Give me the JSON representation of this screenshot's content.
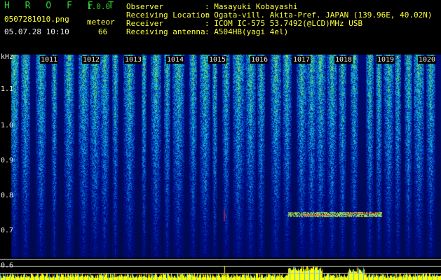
{
  "app": {
    "title": "H R O F F T",
    "version": "1.0.0",
    "filename": "0507281010.png",
    "datetime": "05.07.28 10:10",
    "mode_label": "meteor",
    "meteor_count": "66"
  },
  "station": {
    "labels": [
      "Observer",
      "Receiving Location",
      "Receiver",
      "Receiving antenna"
    ],
    "values": [
      ": Masayuki Kobayashi",
      ": Ogata-vill. Akita-Pref. JAPAN (139.96E, 40.02N)",
      ": ICOM IC-575 53.7492(@LCD)MHz USB",
      ": A504HB(yagi 4el)"
    ]
  },
  "spectrogram": {
    "y_unit": "kHz",
    "y_ticks": [
      "1.1",
      "1.0",
      "0.9",
      "0.8",
      "0.7",
      "0.6"
    ],
    "time_ticks": [
      "1011",
      "1012",
      "1013",
      "1014",
      "1015",
      "1016",
      "1017",
      "1018",
      "1019",
      "1020"
    ],
    "colors": {
      "low": "#001a8c",
      "mid": "#1fa0d0",
      "high": "#20e020",
      "meteor": "#ff3030",
      "level": "#ffff00"
    }
  }
}
